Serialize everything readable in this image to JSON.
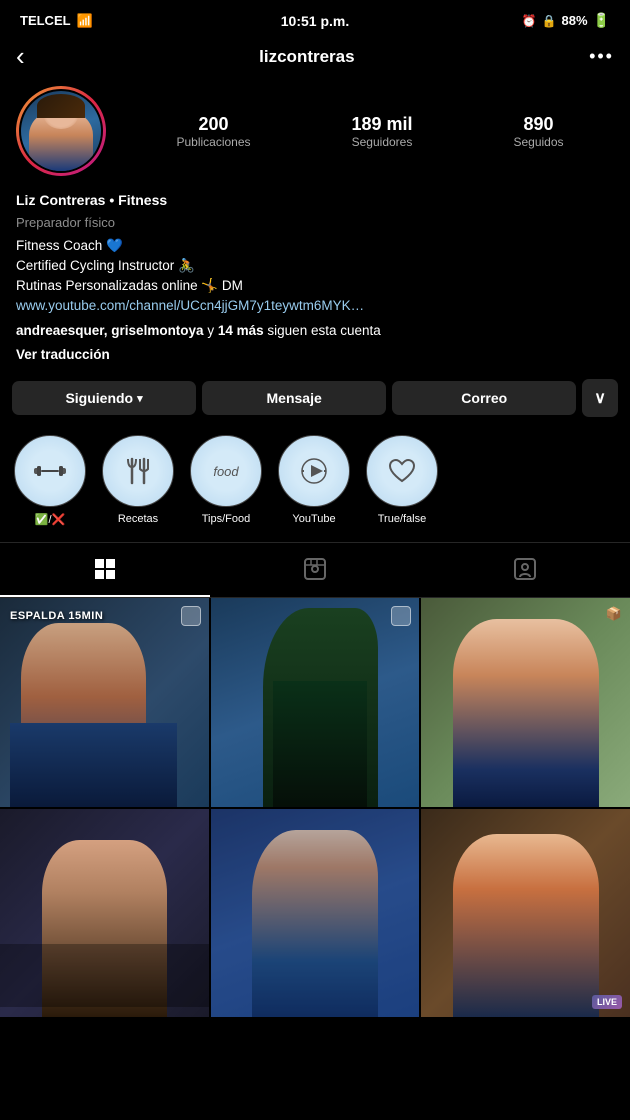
{
  "status_bar": {
    "carrier": "TELCEL",
    "time": "10:51 p.m.",
    "battery": "88%"
  },
  "header": {
    "username": "lizcontreras",
    "back_label": "‹",
    "more_label": "•••"
  },
  "profile": {
    "stats": {
      "posts_count": "200",
      "posts_label": "Publicaciones",
      "followers_count": "189 mil",
      "followers_label": "Seguidores",
      "following_count": "890",
      "following_label": "Seguidos"
    },
    "name": "Liz Contreras • Fitness",
    "category": "Preparador físico",
    "bio_line1": "Fitness Coach 💙",
    "bio_line2": "Certified Cycling Instructor 🚴",
    "bio_line3": "Rutinas Personalizadas online 🤸 DM",
    "bio_link": "www.youtube.com/channel/UCcn4jjGM7y1teywtm6MYK…",
    "bio_followers_mention": "andreaesquer, griselmontoya y 14 más siguen esta cuenta",
    "bio_translate": "Ver traducción"
  },
  "buttons": {
    "siguiendo": "Siguiendo",
    "mensaje": "Mensaje",
    "correo": "Correo",
    "more": "∨"
  },
  "highlights": [
    {
      "id": "1",
      "label": "✅/❌",
      "icon_type": "dumbbell"
    },
    {
      "id": "2",
      "label": "Recetas",
      "icon_type": "fork"
    },
    {
      "id": "3",
      "label": "Tips/Food",
      "icon_type": "food"
    },
    {
      "id": "4",
      "label": "YouTube",
      "icon_type": "play"
    },
    {
      "id": "5",
      "label": "True/false",
      "icon_type": "heart"
    }
  ],
  "tabs": [
    {
      "id": "grid",
      "label": "Grid",
      "active": true
    },
    {
      "id": "reels",
      "label": "Reels",
      "active": false
    },
    {
      "id": "tagged",
      "label": "Tagged",
      "active": false
    }
  ],
  "grid_photos": [
    {
      "id": "1",
      "has_badge": true,
      "caption": "ESPALDA 15MIN",
      "type": "back_workout"
    },
    {
      "id": "2",
      "has_badge": true,
      "type": "side_profile"
    },
    {
      "id": "3",
      "has_badge": false,
      "type": "outdoor"
    },
    {
      "id": "4",
      "has_badge": false,
      "type": "indoor"
    },
    {
      "id": "5",
      "has_badge": false,
      "type": "pool"
    },
    {
      "id": "6",
      "has_badge": false,
      "type": "live",
      "has_live": true
    }
  ],
  "colors": {
    "background": "#000000",
    "surface": "#262626",
    "accent": "#ffffff",
    "muted": "#8e8e8e",
    "gradient_start": "#f09433",
    "gradient_end": "#bc1888"
  }
}
